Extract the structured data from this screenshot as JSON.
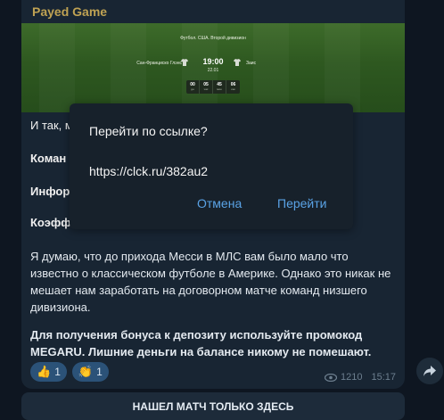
{
  "message": {
    "sender": "Payed Game",
    "banner": {
      "league": "Футбол. США. Второй дивизион",
      "home_team": "Сан-Франциско Глэнс",
      "away_team": "Заис",
      "time": "19:00",
      "date": "22.01",
      "countdown": [
        {
          "value": "00",
          "unit": "дн"
        },
        {
          "value": "05",
          "unit": "час"
        },
        {
          "value": "45",
          "unit": "мин"
        },
        {
          "value": "06",
          "unit": "сек"
        }
      ]
    },
    "partial_lines": [
      "И так, м",
      "Коман",
      "Инфор",
      "Коэфф"
    ],
    "paragraph1": "Я думаю, что до прихода Месси в МЛС вам было мало что известно о классическом футболе в Америке. Однако это никак не мешает нам заработать на договорном матче команд низшего дивизиона.",
    "paragraph2": "Для получения бонуса к депозиту используйте промокод MEGARU. Лишние деньги на балансе никому не помешают.",
    "reactions": [
      {
        "emoji": "👍",
        "count": "1"
      },
      {
        "emoji": "👏",
        "count": "1"
      }
    ],
    "views": "1210",
    "time": "15:17",
    "button_label": "НАШЕЛ МАТЧ ТОЛЬКО ЗДЕСЬ"
  },
  "dialog": {
    "title": "Перейти по ссылке?",
    "url": "https://clck.ru/382au2",
    "cancel_label": "Отмена",
    "confirm_label": "Перейти"
  },
  "colors": {
    "background": "#0e1621",
    "bubble": "#182533",
    "accent": "#5aa3e6",
    "sender": "#bfa253"
  }
}
